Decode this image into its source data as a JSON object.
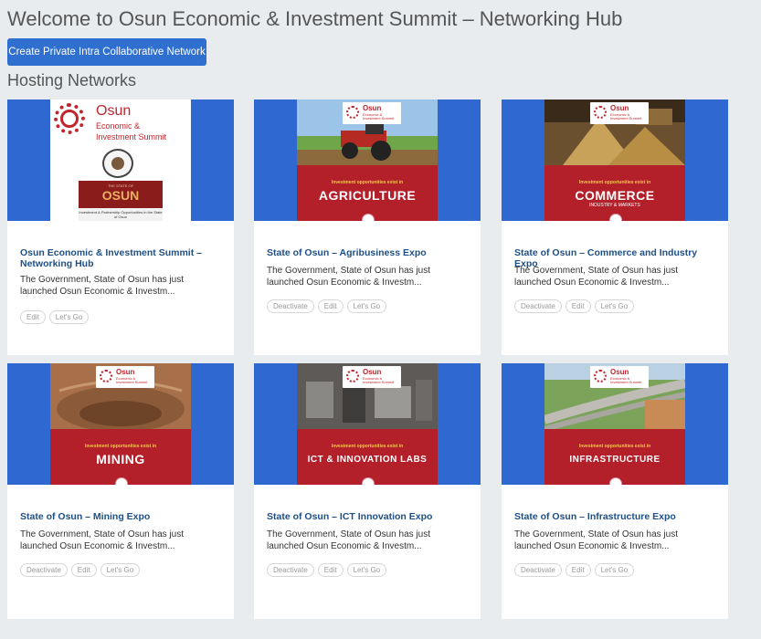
{
  "header": {
    "title": "Welcome to Osun Economic & Investment Summit – Networking Hub",
    "create_button": "Create Private Intra Collaborative Network"
  },
  "section_title": "Hosting Networks",
  "main_poster": {
    "osun": "Osun",
    "line1": "Economic &",
    "line2": "Investment Summit",
    "box_top": "THE STATE OF",
    "box_word": "OSUN",
    "box_bottom": "Investment & Partnership Opportunities in the State of Osun"
  },
  "poster_common": {
    "logo_word": "Osun",
    "logo_sub": "Economic & Investment Summit",
    "exist": "Investment opportunities exist in"
  },
  "cards": [
    {
      "title": "Osun Economic & Investment Summit – Networking Hub",
      "description": "The Government, State of Osun has just launched Osun Economic & Investm...",
      "actions": [
        "Edit",
        "Let's Go"
      ]
    },
    {
      "title": "State of Osun – Agribusiness Expo",
      "description": "The Government, State of Osun has just launched Osun Economic & Investm...",
      "actions": [
        "Deactivate",
        "Edit",
        "Let's Go"
      ],
      "sector": "AGRICULTURE",
      "subsector": ""
    },
    {
      "title": "State of Osun – Commerce and Industry Expo",
      "description": "The Government, State of Osun has just launched Osun Economic & Investm...",
      "actions": [
        "Deactivate",
        "Edit",
        "Let's Go"
      ],
      "sector": "COMMERCE",
      "subsector": "INDUSTRY & MARKETS"
    },
    {
      "title": "State of Osun – Mining Expo",
      "description": "The Government, State of Osun has just launched Osun Economic & Investm...",
      "actions": [
        "Deactivate",
        "Edit",
        "Let's Go"
      ],
      "sector": "MINING",
      "subsector": ""
    },
    {
      "title": "State of Osun – ICT Innovation Expo",
      "description": "The Government, State of Osun has just launched Osun Economic & Investm...",
      "actions": [
        "Deactivate",
        "Edit",
        "Let's Go"
      ],
      "sector": "ICT & INNOVATION LABS",
      "subsector": ""
    },
    {
      "title": "State of Osun – Infrastructure Expo",
      "description": "The Government, State of Osun has just launched Osun Economic & Investm...",
      "actions": [
        "Deactivate",
        "Edit",
        "Let's Go"
      ],
      "sector": "INFRASTRUCTURE",
      "subsector": ""
    }
  ],
  "colors": {
    "background": "#e9ecef",
    "button": "#2f6fcf",
    "banner": "#2f68d0",
    "poster_red": "#b3202a",
    "title_link": "#1e4f86"
  }
}
